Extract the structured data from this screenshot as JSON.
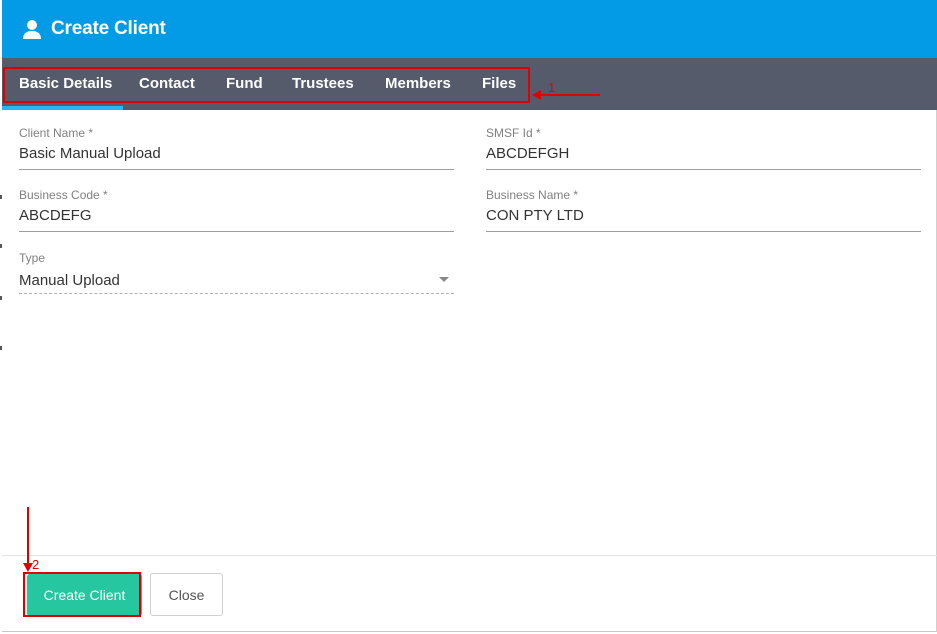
{
  "dialog": {
    "title": "Create Client",
    "header_icon": "person-icon",
    "header_color": "#039be5"
  },
  "tabs": [
    {
      "label": "Basic Details",
      "active": true
    },
    {
      "label": "Contact",
      "active": false
    },
    {
      "label": "Fund",
      "active": false
    },
    {
      "label": "Trustees",
      "active": false
    },
    {
      "label": "Members",
      "active": false
    },
    {
      "label": "Files",
      "active": false
    }
  ],
  "form": {
    "client_name": {
      "label": "Client Name *",
      "value": "Basic Manual Upload"
    },
    "smsf_id": {
      "label": "SMSF Id *",
      "value": "ABCDEFGH"
    },
    "business_code": {
      "label": "Business Code *",
      "value": "ABCDEFG"
    },
    "business_name": {
      "label": "Business Name *",
      "value": "CON PTY LTD"
    },
    "type": {
      "label": "Type",
      "value": "Manual Upload"
    }
  },
  "footer": {
    "create_label": "Create Client",
    "close_label": "Close",
    "create_color": "#26c6a0"
  },
  "annotations": {
    "marker_1": "1",
    "marker_2": "2",
    "color": "#e00000"
  }
}
